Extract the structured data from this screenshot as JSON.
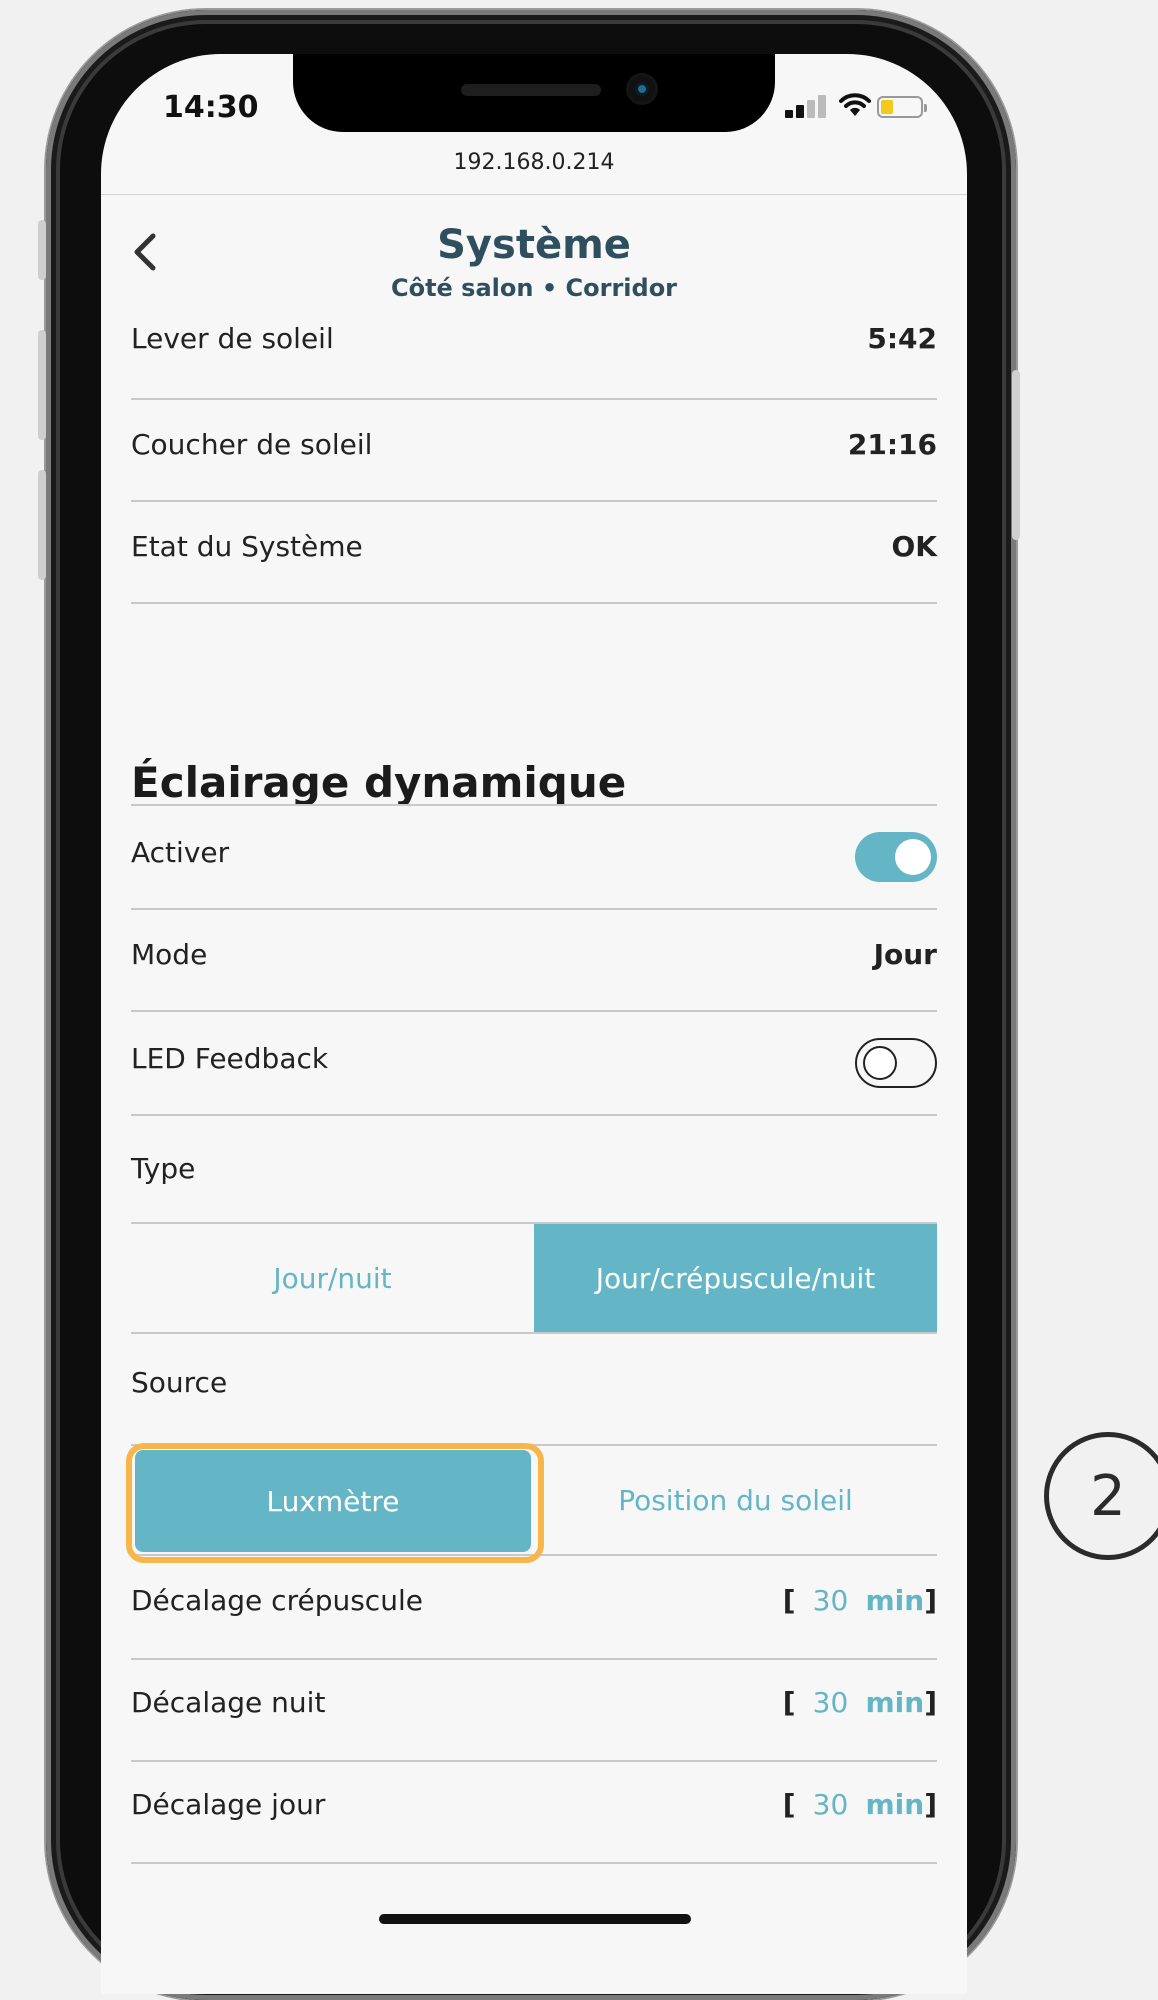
{
  "status_bar": {
    "time": "14:30",
    "icons": [
      "signal-icon",
      "wifi-icon",
      "battery-icon"
    ]
  },
  "browser": {
    "url": "192.168.0.214"
  },
  "nav": {
    "back_icon": "chevron-left-icon",
    "title": "Système",
    "subtitle": "Côté salon • Corridor"
  },
  "system_rows": [
    {
      "label": "Lever de soleil",
      "value": "5:42"
    },
    {
      "label": "Coucher de soleil",
      "value": "21:16"
    },
    {
      "label": "Etat du Système",
      "value": "OK"
    }
  ],
  "dynamic_lighting": {
    "title": "Éclairage dynamique",
    "activer": {
      "label": "Activer",
      "on": true
    },
    "mode": {
      "label": "Mode",
      "value": "Jour"
    },
    "led_feedback": {
      "label": "LED Feedback",
      "on": false
    },
    "type": {
      "label": "Type",
      "options": [
        "Jour/nuit",
        "Jour/crépuscule/nuit"
      ],
      "selected": "Jour/crépuscule/nuit"
    },
    "source": {
      "label": "Source",
      "options": [
        "Luxmètre",
        "Position du soleil"
      ],
      "selected": "Luxmètre"
    },
    "offsets": [
      {
        "label": "Décalage crépuscule",
        "open": "[",
        "value": "30",
        "unit": "min",
        "close": "]"
      },
      {
        "label": "Décalage nuit",
        "open": "[",
        "value": "30",
        "unit": "min",
        "close": "]"
      },
      {
        "label": "Décalage jour",
        "open": "[",
        "value": "30",
        "unit": "min",
        "close": "]"
      }
    ]
  },
  "callout": {
    "number": "2"
  },
  "colors": {
    "accent": "#64b6c6",
    "highlight": "#f7b64a",
    "title": "#2f4f5f"
  }
}
